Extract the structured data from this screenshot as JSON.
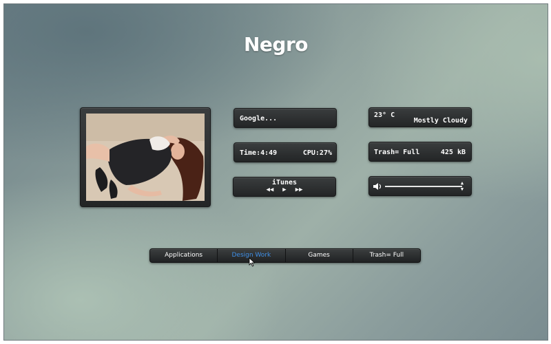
{
  "page": {
    "title": "Negro"
  },
  "widgets": {
    "google": {
      "label": "Google..."
    },
    "system": {
      "time": "Time:4:49",
      "cpu": "CPU:27%"
    },
    "itunes": {
      "label": "iTunes",
      "controls": [
        {
          "icon": "rewind-icon",
          "glyph": "◀◀"
        },
        {
          "icon": "play-icon",
          "glyph": "▶"
        },
        {
          "icon": "fast-forward-icon",
          "glyph": "▶▶"
        }
      ]
    },
    "weather": {
      "temperature": "23° C",
      "condition": "Mostly Cloudy"
    },
    "trash": {
      "status": "Trash= Full",
      "size": "425 kB"
    },
    "volume": {
      "icon": "speaker-icon",
      "up_icon": "arrow-up-icon",
      "down_icon": "arrow-down-icon"
    }
  },
  "photo": {
    "icon": "photo-frame-image"
  },
  "dock": {
    "items": [
      {
        "label": "Applications"
      },
      {
        "label": "Design Work"
      },
      {
        "label": "Games"
      },
      {
        "label": "Trash= Full"
      }
    ],
    "active_index": 1,
    "active_color": "#3f8fe6"
  },
  "colors": {
    "panel": "#2d3031",
    "text": "#ffffff",
    "background": "#8d9f9c"
  }
}
